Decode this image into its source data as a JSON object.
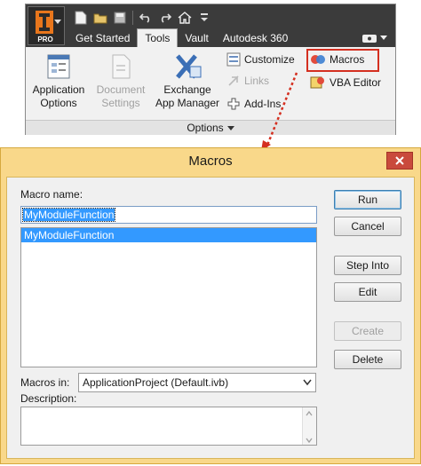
{
  "ribbon": {
    "app_button": {
      "label": "PRO",
      "logo_letter": "I"
    },
    "tabs": [
      {
        "label": "Get Started",
        "active": false
      },
      {
        "label": "Tools",
        "active": true
      },
      {
        "label": "Vault",
        "active": false
      },
      {
        "label": "Autodesk 360",
        "active": false
      }
    ],
    "buttons": {
      "application_options": {
        "line1": "Application",
        "line2": "Options"
      },
      "document_settings": {
        "line1": "Document",
        "line2": "Settings"
      },
      "exchange_app_manager": {
        "line1": "Exchange",
        "line2": "App Manager"
      },
      "customize": "Customize",
      "links": "Links",
      "add_ins": "Add-Ins",
      "macros": "Macros",
      "vba_editor": "VBA Editor"
    },
    "panel_title": "Options",
    "highlight_color": "#d42f20"
  },
  "dialog": {
    "title": "Macros",
    "macro_name_label": "Macro name:",
    "macro_name_value": "MyModuleFunction",
    "macro_list": [
      "MyModuleFunction"
    ],
    "buttons": {
      "run": "Run",
      "cancel": "Cancel",
      "step_into": "Step Into",
      "edit": "Edit",
      "create": "Create",
      "delete": "Delete"
    },
    "macros_in_label": "Macros in:",
    "macros_in_value": "ApplicationProject (Default.ivb)",
    "description_label": "Description:",
    "description_value": ""
  }
}
